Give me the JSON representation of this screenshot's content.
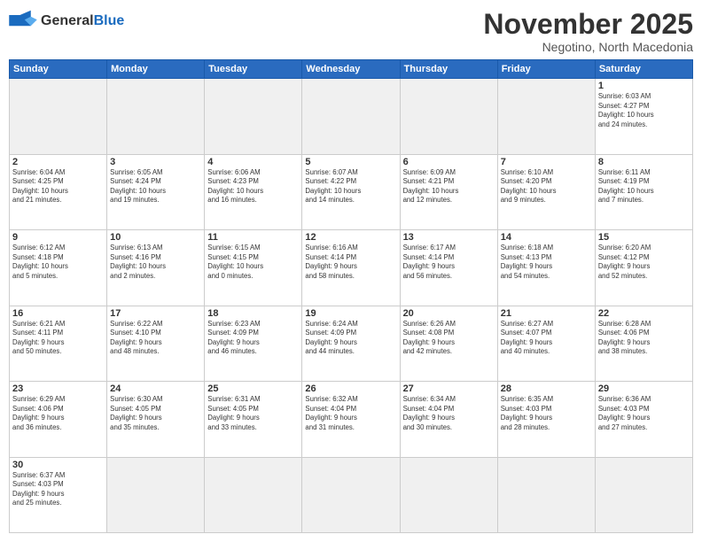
{
  "header": {
    "logo": {
      "general": "General",
      "blue": "Blue"
    },
    "title": "November 2025",
    "subtitle": "Negotino, North Macedonia"
  },
  "calendar": {
    "days_of_week": [
      "Sunday",
      "Monday",
      "Tuesday",
      "Wednesday",
      "Thursday",
      "Friday",
      "Saturday"
    ],
    "weeks": [
      [
        {
          "day": "",
          "info": "",
          "empty": true
        },
        {
          "day": "",
          "info": "",
          "empty": true
        },
        {
          "day": "",
          "info": "",
          "empty": true
        },
        {
          "day": "",
          "info": "",
          "empty": true
        },
        {
          "day": "",
          "info": "",
          "empty": true
        },
        {
          "day": "",
          "info": "",
          "empty": true
        },
        {
          "day": "1",
          "info": "Sunrise: 6:03 AM\nSunset: 4:27 PM\nDaylight: 10 hours\nand 24 minutes.",
          "empty": false
        }
      ],
      [
        {
          "day": "2",
          "info": "Sunrise: 6:04 AM\nSunset: 4:25 PM\nDaylight: 10 hours\nand 21 minutes.",
          "empty": false
        },
        {
          "day": "3",
          "info": "Sunrise: 6:05 AM\nSunset: 4:24 PM\nDaylight: 10 hours\nand 19 minutes.",
          "empty": false
        },
        {
          "day": "4",
          "info": "Sunrise: 6:06 AM\nSunset: 4:23 PM\nDaylight: 10 hours\nand 16 minutes.",
          "empty": false
        },
        {
          "day": "5",
          "info": "Sunrise: 6:07 AM\nSunset: 4:22 PM\nDaylight: 10 hours\nand 14 minutes.",
          "empty": false
        },
        {
          "day": "6",
          "info": "Sunrise: 6:09 AM\nSunset: 4:21 PM\nDaylight: 10 hours\nand 12 minutes.",
          "empty": false
        },
        {
          "day": "7",
          "info": "Sunrise: 6:10 AM\nSunset: 4:20 PM\nDaylight: 10 hours\nand 9 minutes.",
          "empty": false
        },
        {
          "day": "8",
          "info": "Sunrise: 6:11 AM\nSunset: 4:19 PM\nDaylight: 10 hours\nand 7 minutes.",
          "empty": false
        }
      ],
      [
        {
          "day": "9",
          "info": "Sunrise: 6:12 AM\nSunset: 4:18 PM\nDaylight: 10 hours\nand 5 minutes.",
          "empty": false
        },
        {
          "day": "10",
          "info": "Sunrise: 6:13 AM\nSunset: 4:16 PM\nDaylight: 10 hours\nand 2 minutes.",
          "empty": false
        },
        {
          "day": "11",
          "info": "Sunrise: 6:15 AM\nSunset: 4:15 PM\nDaylight: 10 hours\nand 0 minutes.",
          "empty": false
        },
        {
          "day": "12",
          "info": "Sunrise: 6:16 AM\nSunset: 4:14 PM\nDaylight: 9 hours\nand 58 minutes.",
          "empty": false
        },
        {
          "day": "13",
          "info": "Sunrise: 6:17 AM\nSunset: 4:14 PM\nDaylight: 9 hours\nand 56 minutes.",
          "empty": false
        },
        {
          "day": "14",
          "info": "Sunrise: 6:18 AM\nSunset: 4:13 PM\nDaylight: 9 hours\nand 54 minutes.",
          "empty": false
        },
        {
          "day": "15",
          "info": "Sunrise: 6:20 AM\nSunset: 4:12 PM\nDaylight: 9 hours\nand 52 minutes.",
          "empty": false
        }
      ],
      [
        {
          "day": "16",
          "info": "Sunrise: 6:21 AM\nSunset: 4:11 PM\nDaylight: 9 hours\nand 50 minutes.",
          "empty": false
        },
        {
          "day": "17",
          "info": "Sunrise: 6:22 AM\nSunset: 4:10 PM\nDaylight: 9 hours\nand 48 minutes.",
          "empty": false
        },
        {
          "day": "18",
          "info": "Sunrise: 6:23 AM\nSunset: 4:09 PM\nDaylight: 9 hours\nand 46 minutes.",
          "empty": false
        },
        {
          "day": "19",
          "info": "Sunrise: 6:24 AM\nSunset: 4:09 PM\nDaylight: 9 hours\nand 44 minutes.",
          "empty": false
        },
        {
          "day": "20",
          "info": "Sunrise: 6:26 AM\nSunset: 4:08 PM\nDaylight: 9 hours\nand 42 minutes.",
          "empty": false
        },
        {
          "day": "21",
          "info": "Sunrise: 6:27 AM\nSunset: 4:07 PM\nDaylight: 9 hours\nand 40 minutes.",
          "empty": false
        },
        {
          "day": "22",
          "info": "Sunrise: 6:28 AM\nSunset: 4:06 PM\nDaylight: 9 hours\nand 38 minutes.",
          "empty": false
        }
      ],
      [
        {
          "day": "23",
          "info": "Sunrise: 6:29 AM\nSunset: 4:06 PM\nDaylight: 9 hours\nand 36 minutes.",
          "empty": false
        },
        {
          "day": "24",
          "info": "Sunrise: 6:30 AM\nSunset: 4:05 PM\nDaylight: 9 hours\nand 35 minutes.",
          "empty": false
        },
        {
          "day": "25",
          "info": "Sunrise: 6:31 AM\nSunset: 4:05 PM\nDaylight: 9 hours\nand 33 minutes.",
          "empty": false
        },
        {
          "day": "26",
          "info": "Sunrise: 6:32 AM\nSunset: 4:04 PM\nDaylight: 9 hours\nand 31 minutes.",
          "empty": false
        },
        {
          "day": "27",
          "info": "Sunrise: 6:34 AM\nSunset: 4:04 PM\nDaylight: 9 hours\nand 30 minutes.",
          "empty": false
        },
        {
          "day": "28",
          "info": "Sunrise: 6:35 AM\nSunset: 4:03 PM\nDaylight: 9 hours\nand 28 minutes.",
          "empty": false
        },
        {
          "day": "29",
          "info": "Sunrise: 6:36 AM\nSunset: 4:03 PM\nDaylight: 9 hours\nand 27 minutes.",
          "empty": false
        }
      ],
      [
        {
          "day": "30",
          "info": "Sunrise: 6:37 AM\nSunset: 4:03 PM\nDaylight: 9 hours\nand 25 minutes.",
          "empty": false
        },
        {
          "day": "",
          "info": "",
          "empty": true
        },
        {
          "day": "",
          "info": "",
          "empty": true
        },
        {
          "day": "",
          "info": "",
          "empty": true
        },
        {
          "day": "",
          "info": "",
          "empty": true
        },
        {
          "day": "",
          "info": "",
          "empty": true
        },
        {
          "day": "",
          "info": "",
          "empty": true
        }
      ]
    ]
  }
}
